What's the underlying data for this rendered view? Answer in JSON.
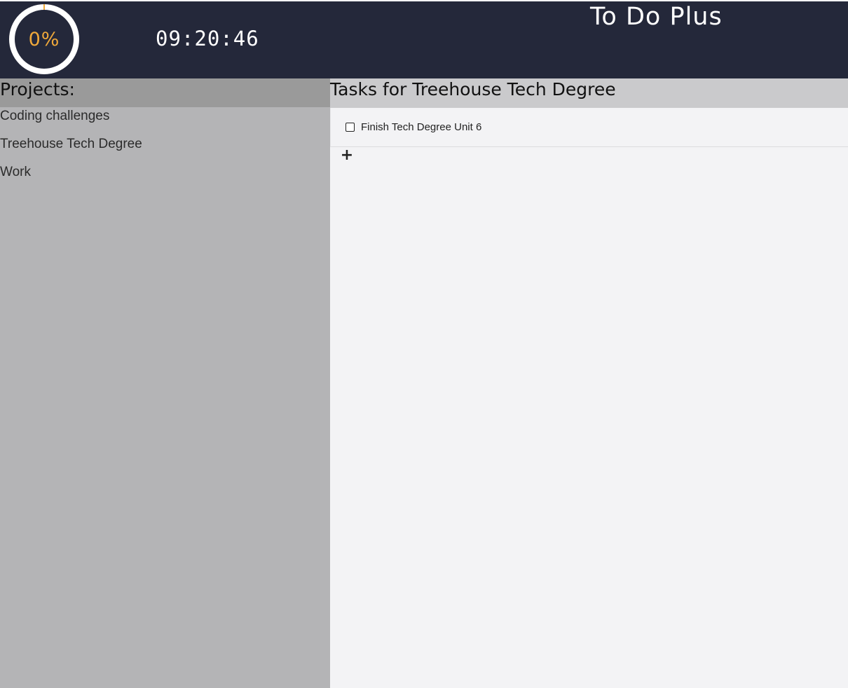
{
  "header": {
    "progress_text": "0%",
    "progress_value": 0,
    "clock": "09:20:46",
    "app_title": "To Do Plus"
  },
  "sidebar": {
    "title": "Projects:",
    "items": [
      {
        "label": "Coding challenges"
      },
      {
        "label": "Treehouse Tech Degree"
      },
      {
        "label": "Work"
      }
    ]
  },
  "main": {
    "title": "Tasks for Treehouse Tech Degree",
    "tasks": [
      {
        "label": "Finish Tech Degree Unit 6",
        "checked": false
      }
    ],
    "add_label": "+"
  },
  "colors": {
    "header_bg": "#24283a",
    "accent": "#f0a93a",
    "sidebar_bg": "#b4b4b6",
    "sidebar_header_bg": "#9a9a9a",
    "main_bg": "#f3f3f5",
    "main_header_bg": "#cacacc"
  }
}
